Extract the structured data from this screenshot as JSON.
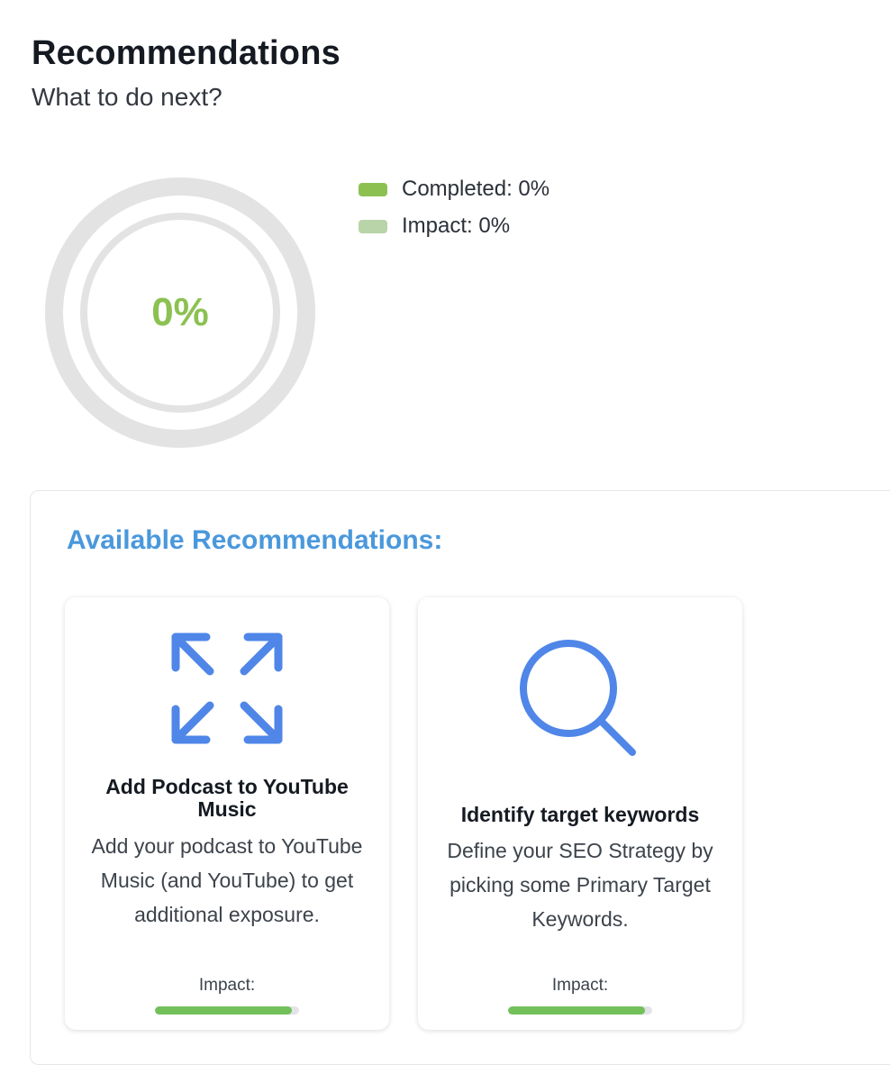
{
  "header": {
    "title": "Recommendations",
    "subtitle": "What to do next?"
  },
  "progress": {
    "center_label": "0%",
    "completed_fraction": 0,
    "impact_fraction": 0,
    "legend": [
      {
        "label": "Completed: 0%",
        "color": "#8cc152"
      },
      {
        "label": "Impact: 0%",
        "color": "#b8d4a8"
      }
    ]
  },
  "panel": {
    "heading": "Available Recommendations:",
    "cards": [
      {
        "icon": "expand-arrows-icon",
        "title": "Add Podcast to YouTube Music",
        "description": "Add your podcast to YouTube Music (and YouTube) to get additional exposure.",
        "impact_label": "Impact:",
        "impact_fraction": 0.95
      },
      {
        "icon": "search-icon",
        "title": "Identify target keywords",
        "description": "Define your SEO Strategy by picking some Primary Target Keywords.",
        "impact_label": "Impact:",
        "impact_fraction": 0.95
      }
    ]
  },
  "colors": {
    "accent_green": "#8cc152",
    "impact_green": "#72c05a",
    "heading_blue": "#4a98dc",
    "icon_blue": "#4f86e8"
  }
}
